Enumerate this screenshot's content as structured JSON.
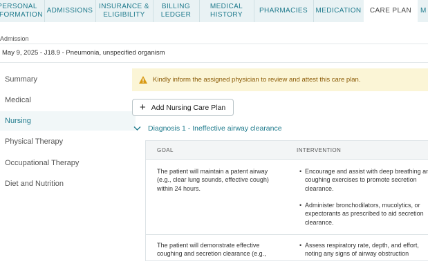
{
  "tabs": [
    {
      "label": "PERSONAL\nINFORMATION"
    },
    {
      "label": "ADMISSIONS"
    },
    {
      "label": "INSURANCE &\nELIGIBILITY"
    },
    {
      "label": "BILLING\nLEDGER"
    },
    {
      "label": "MEDICAL\nHISTORY"
    },
    {
      "label": "PHARMACIES"
    },
    {
      "label": "MEDICATION"
    },
    {
      "label": "CARE PLAN"
    },
    {
      "label": "M"
    }
  ],
  "admission": {
    "label": "Admission",
    "value": "May 9, 2025 - J18.9 - Pneumonia, unspecified organism"
  },
  "sidebar": {
    "items": [
      {
        "label": "Summary"
      },
      {
        "label": "Medical"
      },
      {
        "label": "Nursing"
      },
      {
        "label": "Physical Therapy"
      },
      {
        "label": "Occupational Therapy"
      },
      {
        "label": "Diet and Nutrition"
      }
    ]
  },
  "alert": {
    "text": "Kindly inform the assigned physician to review and attest this care plan."
  },
  "add_button": {
    "label": "Add Nursing Care Plan"
  },
  "diagnosis": {
    "label": "Diagnosis 1 - Ineffective airway clearance"
  },
  "table": {
    "headers": {
      "goal": "GOAL",
      "intervention": "INTERVENTION"
    },
    "rows": [
      {
        "goal": "The patient will maintain a patent airway (e.g., clear lung sounds, effective cough) within 24 hours.",
        "interventions": [
          "Encourage and assist with deep breathing and coughing exercises to promote secretion clearance.",
          "Administer bronchodilators, mucolytics, or expectorants as prescribed to aid secretion clearance."
        ]
      },
      {
        "goal": "The patient will demonstrate effective coughing and secretion clearance (e.g.,",
        "interventions": [
          "Assess respiratory rate, depth, and effort, noting any signs of airway obstruction"
        ]
      }
    ]
  }
}
